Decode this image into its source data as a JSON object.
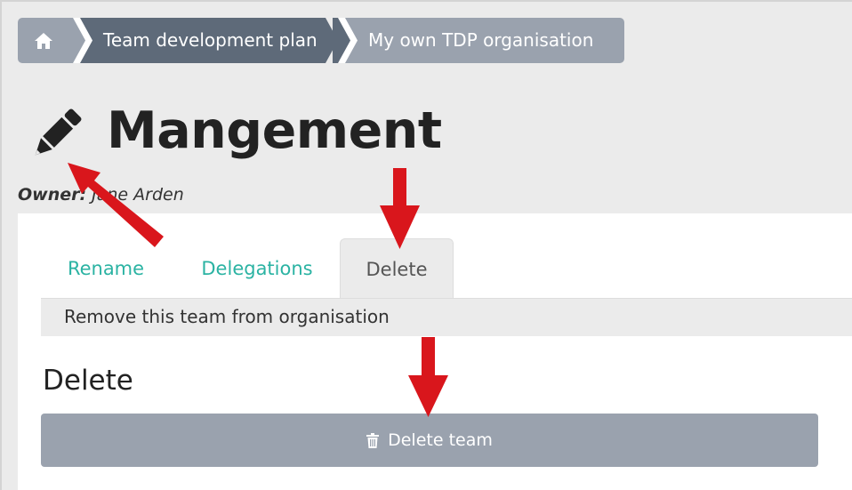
{
  "breadcrumb": {
    "home_icon": "home-icon",
    "items": [
      "Team development plan",
      "My own TDP organisation"
    ]
  },
  "page": {
    "title": "Mangement",
    "edit_icon": "pencil-icon",
    "owner_label": "Owner:",
    "owner_name": "Jane Arden"
  },
  "tabs": [
    {
      "label": "Rename",
      "active": false
    },
    {
      "label": "Delegations",
      "active": false
    },
    {
      "label": "Delete",
      "active": true
    }
  ],
  "tab_description": "Remove this team from organisation",
  "section": {
    "title": "Delete",
    "button_label": "Delete team",
    "button_icon": "trash-icon"
  },
  "colors": {
    "accent_link": "#2bb3a3",
    "breadcrumb_dark": "#5e6a79",
    "breadcrumb_light": "#9aa2ae",
    "annotation_arrow": "#d9161c"
  }
}
